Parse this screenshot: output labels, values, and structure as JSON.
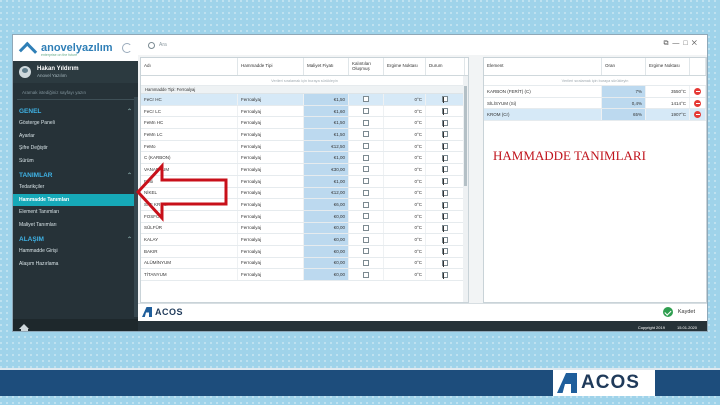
{
  "app": {
    "logo_text": "anovelyazılım",
    "logo_sub": "enterprise on the future",
    "search_placeholder": "Ara"
  },
  "user": {
    "name": "Hakan Yıldırım",
    "role": "Anovel Yazılım"
  },
  "sidebar": {
    "search_placeholder": "Aramak istediğiniz sayfayı yazın",
    "sections": [
      {
        "title": "GENEL",
        "items": [
          "Gösterge Paneli",
          "Ayarlar",
          "Şifre Değiştir",
          "Sürüm"
        ]
      },
      {
        "title": "TANIMLAR",
        "items": [
          "Tedarikçiler",
          "Hammadde Tanımları",
          "Element Tanımları",
          "Maliyet Tanımları"
        ]
      },
      {
        "title": "ALAŞIM",
        "items": [
          "Hammadde Girişi",
          "Alaşım Hazırlama"
        ]
      }
    ],
    "active_item": "Hammadde Tanımları"
  },
  "left_grid": {
    "headers": [
      "Adı",
      "Hammadde Tipi",
      "Maliyet Fiyatı",
      "Kalıntıları Oluşmuş",
      "Ergime Noktası",
      "Durum"
    ],
    "filter_hint": "Verileri sıralamak için buraya sürükleyin",
    "group_label": "Hammadde Tipi: Ferroalyaj",
    "rows": [
      {
        "name": "FeCr HC",
        "type": "Ferroalyaj",
        "cost": "€1,50",
        "temp": "0°C",
        "selected": true
      },
      {
        "name": "FeCr LC",
        "type": "Ferroalyaj",
        "cost": "€1,60",
        "temp": "0°C"
      },
      {
        "name": "FeMn HC",
        "type": "Ferroalyaj",
        "cost": "€1,50",
        "temp": "0°C"
      },
      {
        "name": "FeMn LC",
        "type": "Ferroalyaj",
        "cost": "€1,50",
        "temp": "0°C"
      },
      {
        "name": "FeMo",
        "type": "Ferroalyaj",
        "cost": "€12,50",
        "temp": "0°C"
      },
      {
        "name": "C (KARBON)",
        "type": "Ferroalyaj",
        "cost": "€1,00",
        "temp": "0°C"
      },
      {
        "name": "VANADYUM",
        "type": "Ferroalyaj",
        "cost": "€30,00",
        "temp": "0°C"
      },
      {
        "name": "FeSi",
        "type": "Ferroalyaj",
        "cost": "€1,00",
        "temp": "0°C"
      },
      {
        "name": "NİKEL",
        "type": "Ferroalyaj",
        "cost": "€12,00",
        "temp": "0°C"
      },
      {
        "name": "SAF KROM",
        "type": "Ferroalyaj",
        "cost": "€6,00",
        "temp": "0°C"
      },
      {
        "name": "FOSFOR",
        "type": "Ferroalyaj",
        "cost": "€0,00",
        "temp": "0°C"
      },
      {
        "name": "SÜLFÜR",
        "type": "Ferroalyaj",
        "cost": "€0,00",
        "temp": "0°C"
      },
      {
        "name": "KALAY",
        "type": "Ferroalyaj",
        "cost": "€0,00",
        "temp": "0°C"
      },
      {
        "name": "BAKIR",
        "type": "Ferroalyaj",
        "cost": "€0,00",
        "temp": "0°C"
      },
      {
        "name": "ALÜMİNYUM",
        "type": "Ferroalyaj",
        "cost": "€0,00",
        "temp": "0°C"
      },
      {
        "name": "TİTANYUM",
        "type": "Ferroalyaj",
        "cost": "€0,00",
        "temp": "0°C"
      }
    ]
  },
  "right_grid": {
    "headers": [
      "Element",
      "Oran",
      "Ergime Noktası"
    ],
    "filter_hint": "Verileri sıralamak için buraya sürükleyin",
    "rows": [
      {
        "element": "KARBON (FERİT) (C)",
        "ratio": "7%",
        "temp": "3550°C"
      },
      {
        "element": "SİLİSYUM (Si)",
        "ratio": "0,4%",
        "temp": "1414°C"
      },
      {
        "element": "KROM (Cr)",
        "ratio": "65%",
        "temp": "1907°C",
        "selected": true
      }
    ]
  },
  "bottom": {
    "brand": "ACOS",
    "save_label": "Kaydet"
  },
  "status": {
    "copyright": "Copyright 2019",
    "date": "15.01.2020"
  },
  "overlay": {
    "title": "HAMMADDE TANIMLARI"
  },
  "slide": {
    "brand": "ACOS"
  }
}
